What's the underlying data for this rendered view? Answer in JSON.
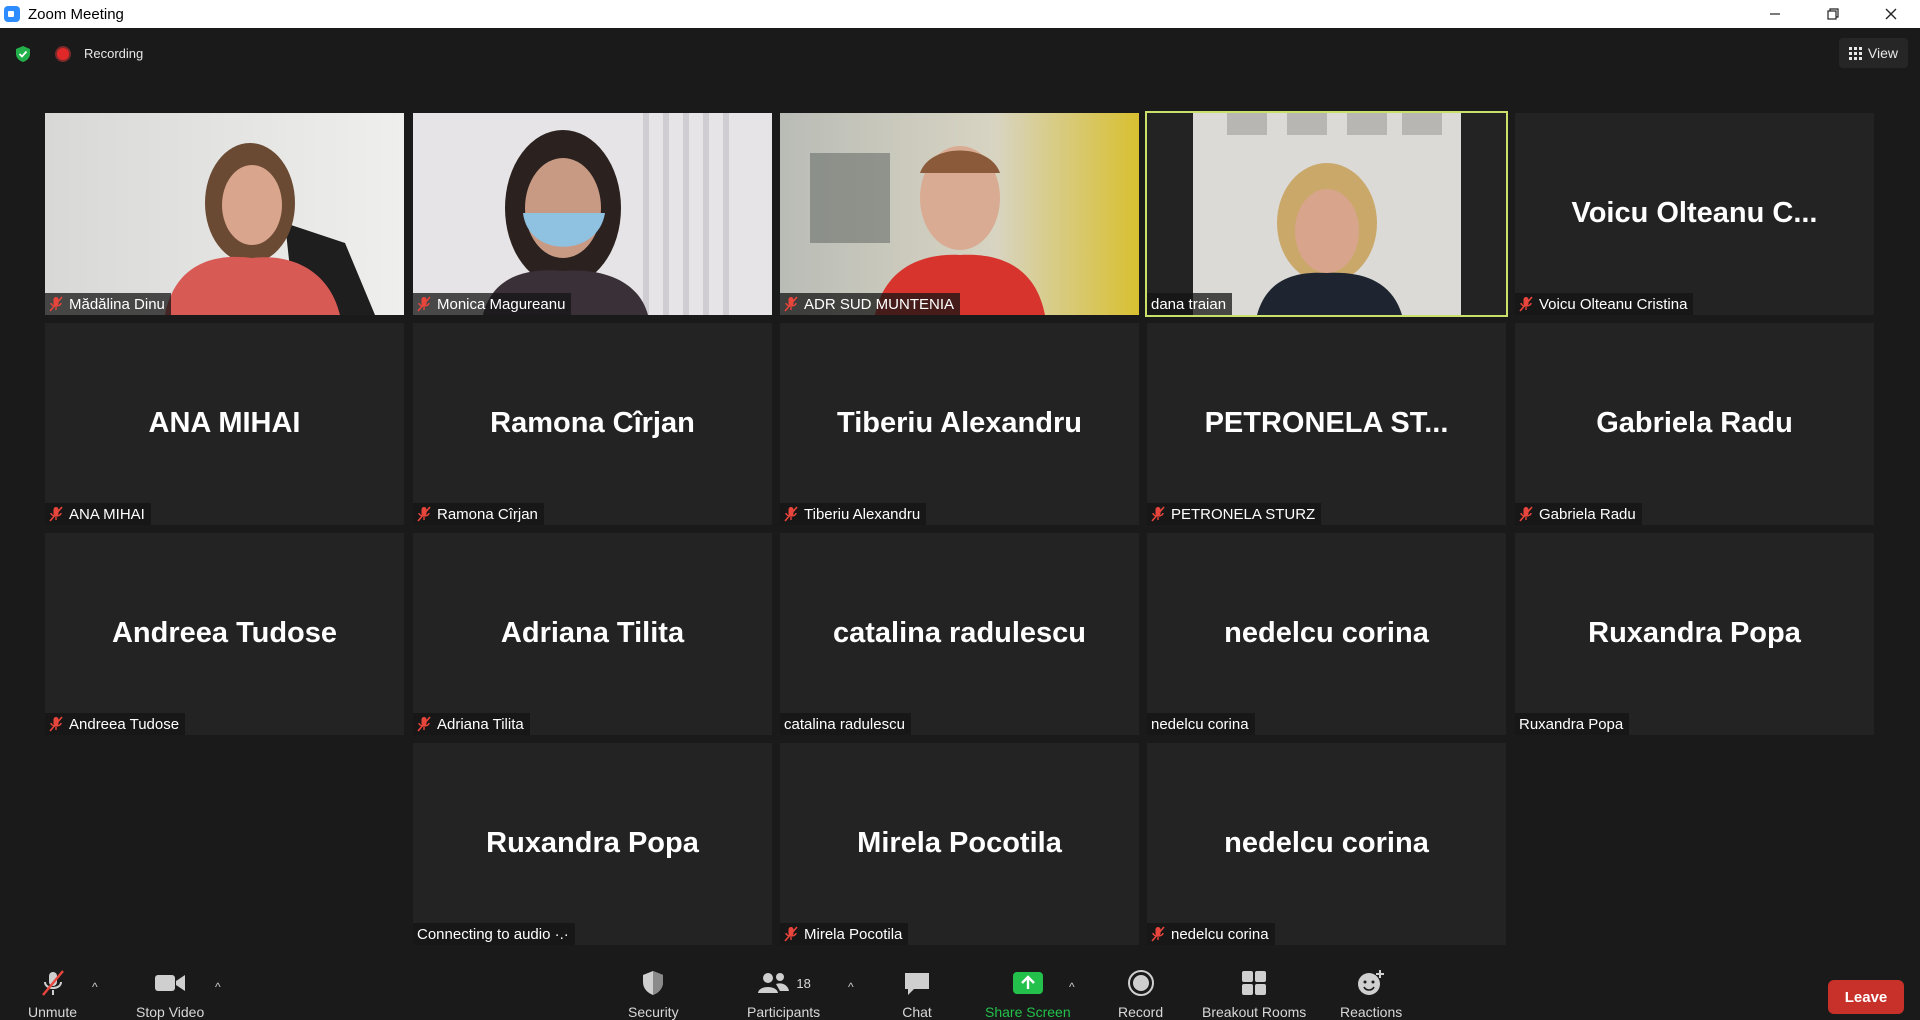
{
  "window": {
    "title": "Zoom Meeting"
  },
  "topbar": {
    "recording_label": "Recording",
    "view_label": "View"
  },
  "tiles": [
    {
      "name": "Mădălina Dinu",
      "muted": true,
      "video": true
    },
    {
      "name": "Monica Magureanu",
      "muted": true,
      "video": true
    },
    {
      "name": "ADR SUD MUNTENIA",
      "muted": true,
      "video": true
    },
    {
      "name": "dana traian",
      "muted": false,
      "video": true,
      "active": true
    },
    {
      "big": "Voicu  Olteanu  C...",
      "name": "Voicu Olteanu Cristina",
      "muted": true
    },
    {
      "big": "ANA MIHAI",
      "name": "ANA MIHAI",
      "muted": true
    },
    {
      "big": "Ramona Cîrjan",
      "name": "Ramona Cîrjan",
      "muted": true
    },
    {
      "big": "Tiberiu Alexandru",
      "name": "Tiberiu Alexandru",
      "muted": true
    },
    {
      "big": "PETRONELA  ST...",
      "name": "PETRONELA STURZ",
      "muted": true
    },
    {
      "big": "Gabriela Radu",
      "name": "Gabriela Radu",
      "muted": true
    },
    {
      "big": "Andreea Tudose",
      "name": "Andreea Tudose",
      "muted": true
    },
    {
      "big": "Adriana Tilita",
      "name": "Adriana Tilita",
      "muted": true
    },
    {
      "big": "catalina radulescu",
      "name": "catalina radulescu",
      "muted": false
    },
    {
      "big": "nedelcu corina",
      "name": "nedelcu corina",
      "muted": false
    },
    {
      "big": "Ruxandra Popa",
      "name": "Ruxandra Popa",
      "muted": false
    },
    {
      "big": "Ruxandra Popa",
      "name": "Connecting to audio ·.·",
      "muted": false
    },
    {
      "big": "Mirela Pocotila",
      "name": "Mirela Pocotila",
      "muted": true
    },
    {
      "big": "nedelcu corina",
      "name": "nedelcu corina",
      "muted": true
    }
  ],
  "toolbar": {
    "unmute": "Unmute",
    "stop_video": "Stop Video",
    "security": "Security",
    "participants": "Participants",
    "participants_count": "18",
    "chat": "Chat",
    "share_screen": "Share Screen",
    "record": "Record",
    "breakout_rooms": "Breakout Rooms",
    "reactions": "Reactions",
    "leave": "Leave"
  }
}
